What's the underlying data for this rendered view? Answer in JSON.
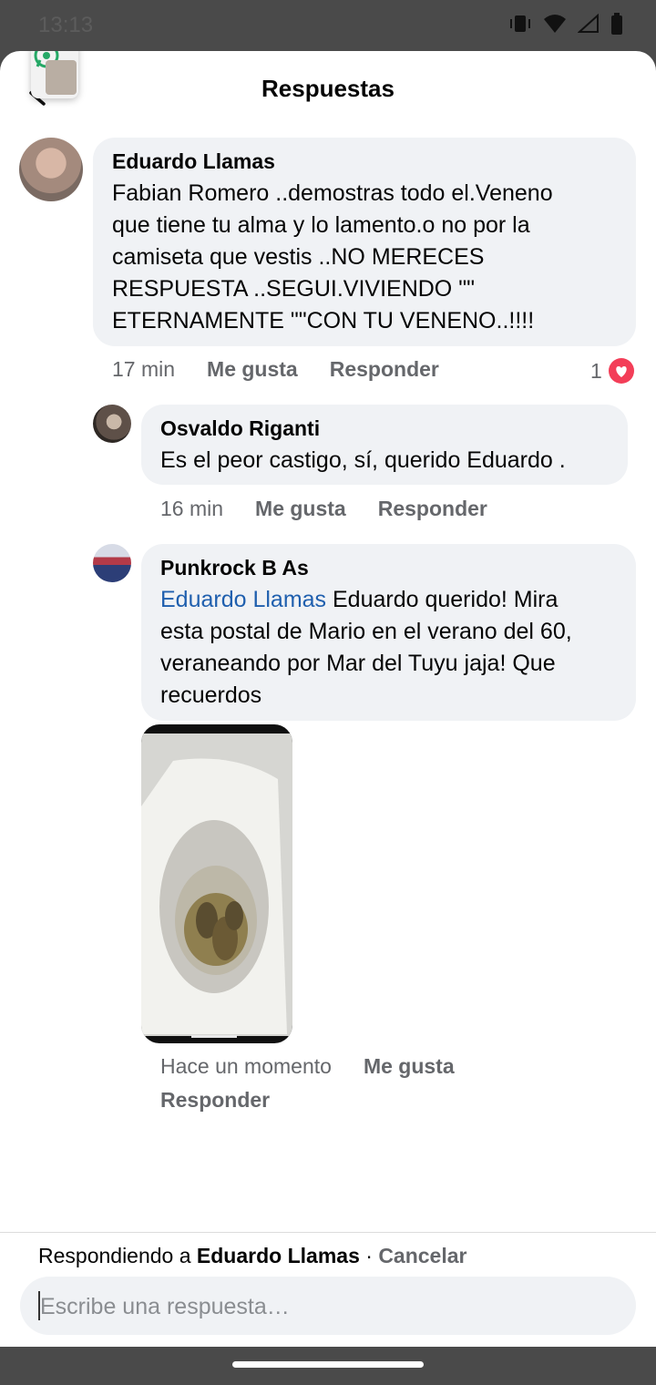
{
  "status_bar": {
    "time": "13:13"
  },
  "header": {
    "title": "Respuestas"
  },
  "comments": [
    {
      "author": "Eduardo Llamas",
      "text_lines": [
        "Fabian Romero ..demostras todo el.Veneno",
        "que tiene tu alma y lo lamento.o no por la",
        "camiseta que vestis  ..NO MERECES",
        "RESPUESTA ..SEGUI.VIVIENDO \"\"",
        "ETERNAMENTE \"\"CON TU VENENO..!!!!"
      ],
      "time": "17 min",
      "like_label": "Me gusta",
      "reply_label": "Responder",
      "reaction_count": "1",
      "reaction_color": "#f33e58"
    },
    {
      "author": "Osvaldo Riganti",
      "text_lines": [
        "Es el peor castigo, sí, querido Eduardo ."
      ],
      "time": "16 min",
      "like_label": "Me gusta",
      "reply_label": "Responder"
    },
    {
      "author": "Punkrock B As",
      "mention": "Eduardo Llamas",
      "text_first_line_rest": " Eduardo querido! Mira",
      "text_lines": [
        "esta postal de Mario en el verano del 60,",
        "veraneando por Mar del Tuyu jaja! Que",
        "recuerdos"
      ],
      "time": "Hace un momento",
      "like_label": "Me gusta",
      "reply_label": "Responder"
    }
  ],
  "footer": {
    "replying_prefix": "Respondiendo a ",
    "replying_name": "Eduardo Llamas",
    "separator": " · ",
    "cancel_label": "Cancelar",
    "input_placeholder": "Escribe una respuesta…"
  },
  "colors": {
    "mention": "#1f5fae",
    "bubble_bg": "#f0f2f5",
    "meta_text": "#65676b"
  }
}
